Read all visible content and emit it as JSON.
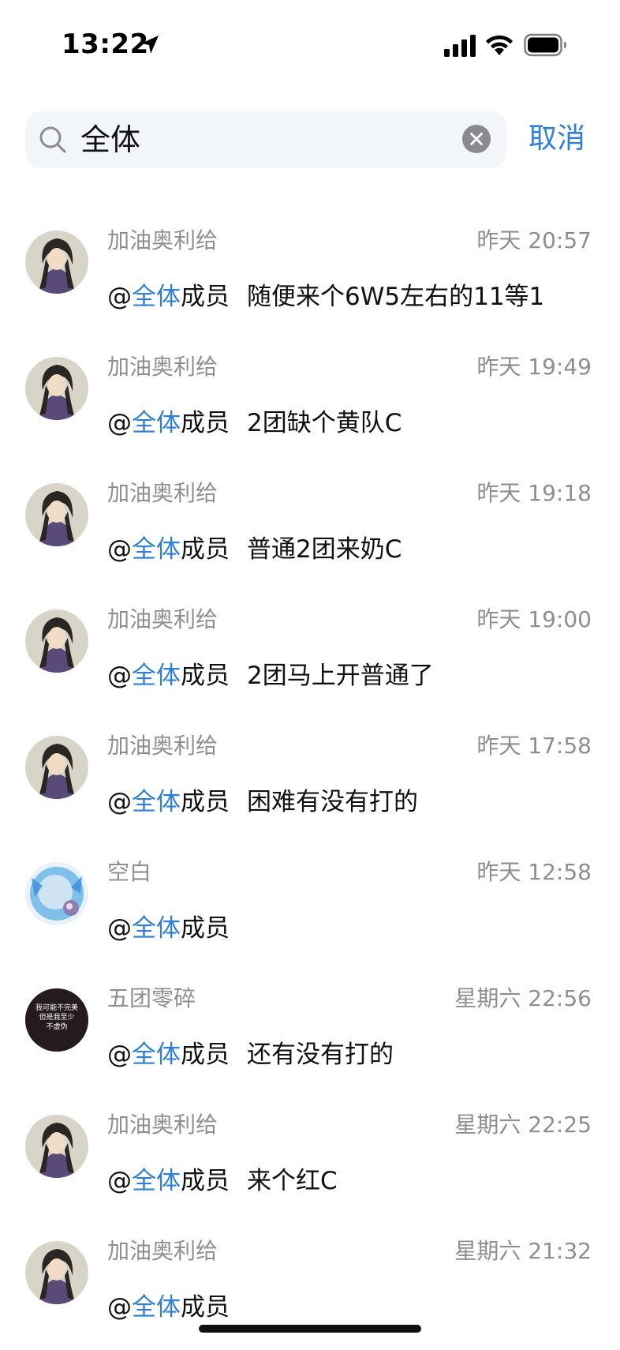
{
  "status_bar": {
    "time": "13:22",
    "icons": [
      "location-arrow-icon",
      "signal-icon",
      "wifi-icon",
      "battery-icon"
    ]
  },
  "search": {
    "query": "全体",
    "cancel_label": "取消"
  },
  "colors": {
    "accent": "#2f7fd6",
    "secondary_text": "#8e8e93",
    "search_bg": "#f2f5fa"
  },
  "results": [
    {
      "sender": "加油奥利给",
      "time": "昨天 20:57",
      "mention_at": "@",
      "mention_highlight": "全体",
      "mention_rest": "成员",
      "body": "随便来个6W5左右的11等1",
      "avatar": "avatar-man"
    },
    {
      "sender": "加油奥利给",
      "time": "昨天 19:49",
      "mention_at": "@",
      "mention_highlight": "全体",
      "mention_rest": "成员",
      "body": "2团缺个黄队C",
      "avatar": "avatar-man"
    },
    {
      "sender": "加油奥利给",
      "time": "昨天 19:18",
      "mention_at": "@",
      "mention_highlight": "全体",
      "mention_rest": "成员",
      "body": "普通2团来奶C",
      "avatar": "avatar-man"
    },
    {
      "sender": "加油奥利给",
      "time": "昨天 19:00",
      "mention_at": "@",
      "mention_highlight": "全体",
      "mention_rest": "成员",
      "body": "2团马上开普通了",
      "avatar": "avatar-man"
    },
    {
      "sender": "加油奥利给",
      "time": "昨天 17:58",
      "mention_at": "@",
      "mention_highlight": "全体",
      "mention_rest": "成员",
      "body": "困难有没有打的",
      "avatar": "avatar-man"
    },
    {
      "sender": "空白",
      "time": "昨天 12:58",
      "mention_at": "@",
      "mention_highlight": "全体",
      "mention_rest": "成员",
      "body": "",
      "avatar": "avatar-blue"
    },
    {
      "sender": "五团零碎",
      "time": "星期六 22:56",
      "mention_at": "@",
      "mention_highlight": "全体",
      "mention_rest": "成员",
      "body": "还有没有打的",
      "avatar": "avatar-dark",
      "avatar_text": [
        "我可能不完美",
        "但是我至少",
        "不虚伪"
      ]
    },
    {
      "sender": "加油奥利给",
      "time": "星期六 22:25",
      "mention_at": "@",
      "mention_highlight": "全体",
      "mention_rest": "成员",
      "body": "来个红C",
      "avatar": "avatar-man"
    },
    {
      "sender": "加油奥利给",
      "time": "星期六 21:32",
      "mention_at": "@",
      "mention_highlight": "全体",
      "mention_rest": "成员",
      "body": "",
      "avatar": "avatar-man"
    }
  ]
}
